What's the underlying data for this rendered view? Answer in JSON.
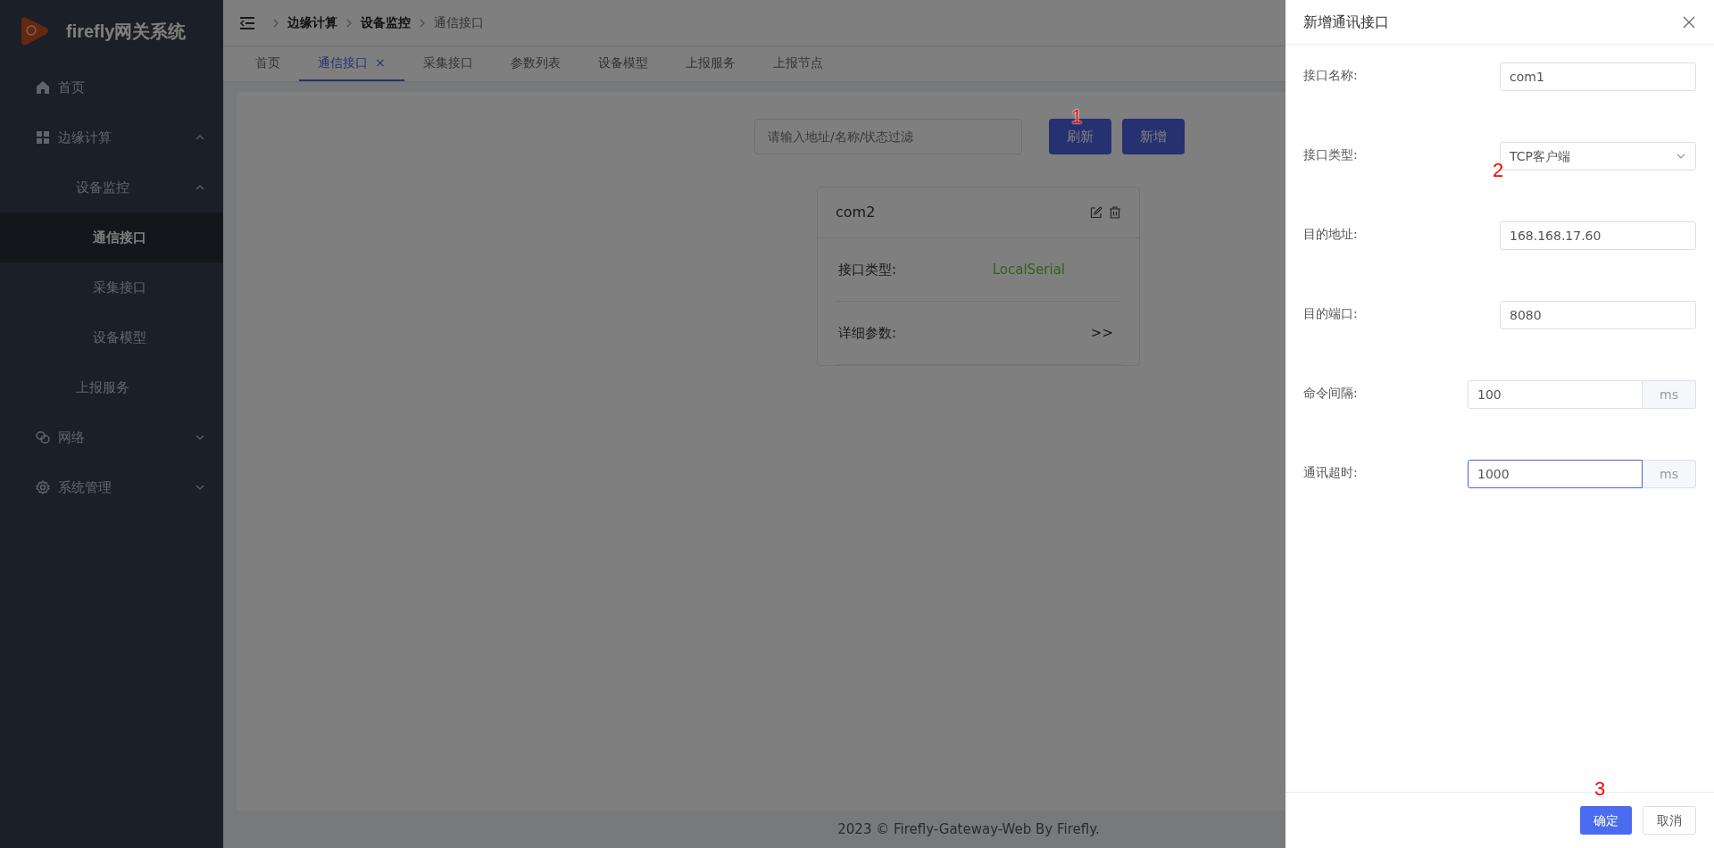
{
  "sidebar": {
    "logo_text": "firefly网关系统",
    "items": [
      {
        "label": "首页",
        "selected": false
      },
      {
        "label": "边缘计算",
        "expanded": true,
        "children": [
          {
            "label": "设备监控",
            "expanded": true,
            "children": [
              {
                "label": "通信接口",
                "selected": true
              },
              {
                "label": "采集接口",
                "selected": false
              },
              {
                "label": "设备模型",
                "selected": false
              }
            ]
          },
          {
            "label": "上报服务",
            "selected": false
          }
        ]
      },
      {
        "label": "网络",
        "expanded": false
      },
      {
        "label": "系统管理",
        "expanded": false
      }
    ]
  },
  "breadcrumb": [
    {
      "label": "边缘计算",
      "current": false
    },
    {
      "label": "设备监控",
      "current": false
    },
    {
      "label": "通信接口",
      "current": true
    }
  ],
  "tabs": [
    {
      "label": "首页",
      "selected": false,
      "closable": false
    },
    {
      "label": "通信接口",
      "selected": true,
      "closable": true,
      "close": "×"
    },
    {
      "label": "采集接口",
      "selected": false,
      "closable": false
    },
    {
      "label": "参数列表",
      "selected": false,
      "closable": false
    },
    {
      "label": "设备模型",
      "selected": false,
      "closable": false
    },
    {
      "label": "上报服务",
      "selected": false,
      "closable": false
    },
    {
      "label": "上报节点",
      "selected": false,
      "closable": false
    }
  ],
  "toolbar": {
    "search": {
      "placeholder": "请输入地址/名称/状态过滤"
    },
    "buttons": [
      "刷新",
      "新增"
    ]
  },
  "cards": [
    {
      "title": "com2",
      "rows": [
        {
          "label": "接口类型:",
          "value": "LocalSerial",
          "kind": "status"
        },
        {
          "label": "详细参数:",
          "value": ">>",
          "kind": "link"
        }
      ]
    }
  ],
  "footer": "2023 © Firefly-Gateway-Web By Firefly.",
  "drawer": {
    "title": "新增通讯接口",
    "fields": [
      {
        "label": "接口名称:",
        "value": "com1",
        "kind": "text",
        "focused": false
      },
      {
        "label": "接口类型:",
        "value": "TCP客户端",
        "kind": "select",
        "focused": false
      },
      {
        "label": "目的地址:",
        "value": "168.168.17.60",
        "kind": "text",
        "focused": false
      },
      {
        "label": "目的端口:",
        "value": "8080",
        "kind": "text",
        "focused": false
      },
      {
        "label": "命令间隔:",
        "value": "100",
        "kind": "suffix",
        "suffix": "ms",
        "focused": false
      },
      {
        "label": "通讯超时:",
        "value": "1000",
        "kind": "suffix",
        "suffix": "ms",
        "focused": true
      }
    ],
    "buttons": [
      {
        "label": "确定",
        "kind": "primary"
      },
      {
        "label": "取消",
        "kind": "default"
      }
    ]
  },
  "annotations": [
    "1",
    "2",
    "3"
  ]
}
